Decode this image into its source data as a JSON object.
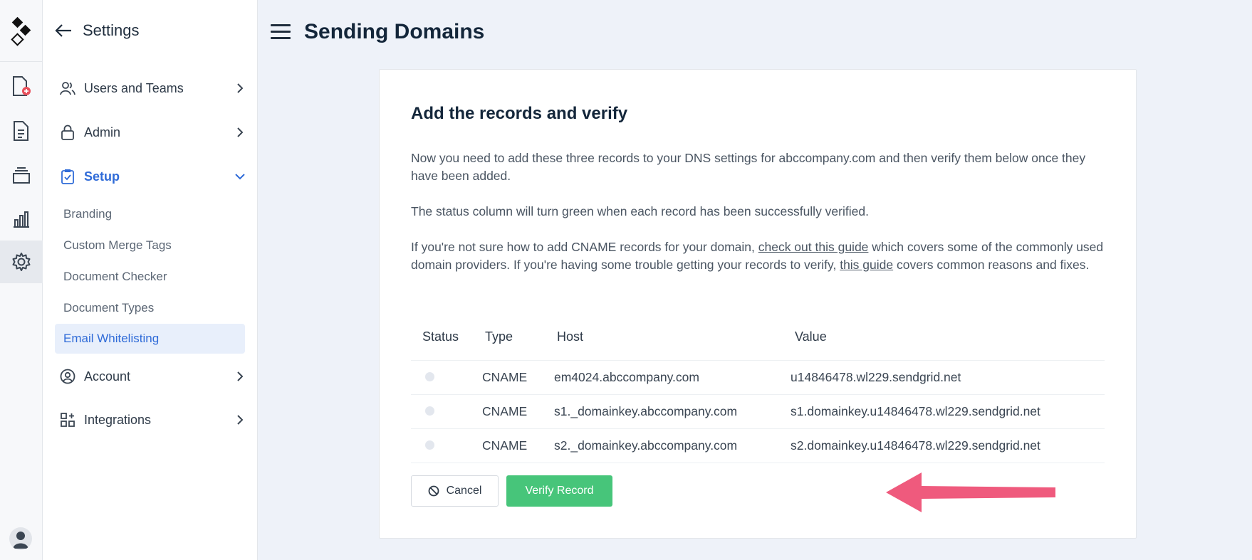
{
  "sidebar": {
    "title": "Settings",
    "items": [
      {
        "label": "Users and Teams"
      },
      {
        "label": "Admin"
      },
      {
        "label": "Setup"
      },
      {
        "label": "Account"
      },
      {
        "label": "Integrations"
      }
    ],
    "setup_children": [
      "Branding",
      "Custom Merge Tags",
      "Document Checker",
      "Document Types",
      "Email Whitelisting"
    ]
  },
  "header": {
    "title": "Sending Domains"
  },
  "card": {
    "heading": "Add the records and verify",
    "p1": "Now you need to add these three records to your DNS settings for abccompany.com and then verify them below once they have been added.",
    "p2": "The status column will turn green when each record has been successfully verified.",
    "p3_a": "If you're not sure how to add CNAME records for your domain, ",
    "p3_link1": "check out this guide",
    "p3_b": " which covers some of the commonly used domain providers. If you're having some trouble getting your records to verify, ",
    "p3_link2": "this guide",
    "p3_c": " covers common reasons and fixes."
  },
  "table": {
    "headers": [
      "Status",
      "Type",
      "Host",
      "Value"
    ],
    "rows": [
      {
        "type": "CNAME",
        "host": "em4024.abccompany.com",
        "value": "u14846478.wl229.sendgrid.net"
      },
      {
        "type": "CNAME",
        "host": "s1._domainkey.abccompany.com",
        "value": "s1.domainkey.u14846478.wl229.sendgrid.net"
      },
      {
        "type": "CNAME",
        "host": "s2._domainkey.abccompany.com",
        "value": "s2.domainkey.u14846478.wl229.sendgrid.net"
      }
    ]
  },
  "actions": {
    "cancel_label": "Cancel",
    "verify_label": "Verify Record"
  },
  "colors": {
    "accent": "#2f6bd8",
    "verify": "#47c57a",
    "arrow": "#ef5a7d"
  }
}
